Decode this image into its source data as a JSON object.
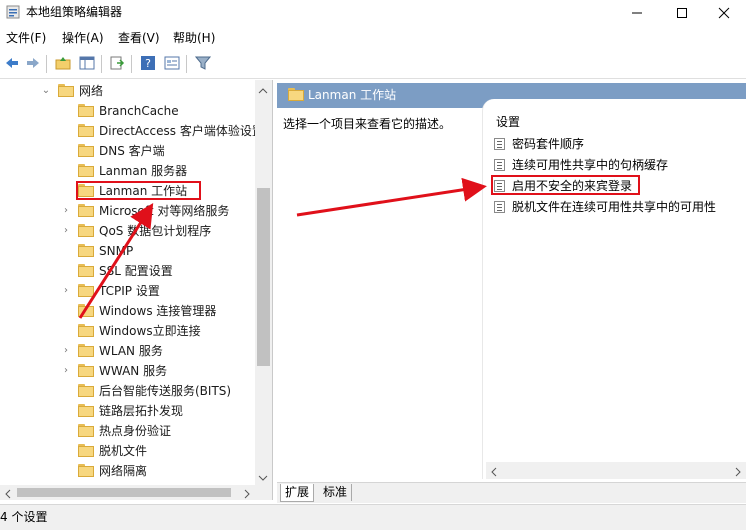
{
  "window": {
    "title": "本地组策略编辑器"
  },
  "menu": [
    "文件(F)",
    "操作(A)",
    "查看(V)",
    "帮助(H)"
  ],
  "toolbar": {
    "icons": [
      "back-arrow-icon",
      "forward-arrow-icon",
      "up-folder-icon",
      "show-hide-tree-icon",
      "export-list-icon",
      "help-icon",
      "properties-icon",
      "filter-icon"
    ]
  },
  "tree": {
    "parent": "网络",
    "items": [
      {
        "label": "BranchCache",
        "expandable": false
      },
      {
        "label": "DirectAccess 客户端体验设置",
        "expandable": false
      },
      {
        "label": "DNS 客户端",
        "expandable": false
      },
      {
        "label": "Lanman 服务器",
        "expandable": false
      },
      {
        "label": "Lanman 工作站",
        "expandable": false,
        "selected": true
      },
      {
        "label": "Microsoft 对等网络服务",
        "expandable": true
      },
      {
        "label": "QoS 数据包计划程序",
        "expandable": true
      },
      {
        "label": "SNMP",
        "expandable": false
      },
      {
        "label": "SSL 配置设置",
        "expandable": false
      },
      {
        "label": "TCPIP 设置",
        "expandable": true
      },
      {
        "label": "Windows 连接管理器",
        "expandable": false
      },
      {
        "label": "Windows立即连接",
        "expandable": false
      },
      {
        "label": "WLAN 服务",
        "expandable": true
      },
      {
        "label": "WWAN 服务",
        "expandable": true
      },
      {
        "label": "后台智能传送服务(BITS)",
        "expandable": false
      },
      {
        "label": "链路层拓扑发现",
        "expandable": false
      },
      {
        "label": "热点身份验证",
        "expandable": false
      },
      {
        "label": "脱机文件",
        "expandable": false
      },
      {
        "label": "网络隔离",
        "expandable": false
      }
    ]
  },
  "right": {
    "header": "Lanman 工作站",
    "description": "选择一个项目来查看它的描述。",
    "settings_heading": "设置",
    "settings": [
      "密码套件顺序",
      "连续可用性共享中的句柄缓存",
      "启用不安全的来宾登录",
      "脱机文件在连续可用性共享中的可用性"
    ]
  },
  "tabs": [
    "扩展",
    "标准"
  ],
  "status": "4 个设置",
  "colors": {
    "header_blue": "#7c9dc4",
    "annotation_red": "#e0101a"
  }
}
